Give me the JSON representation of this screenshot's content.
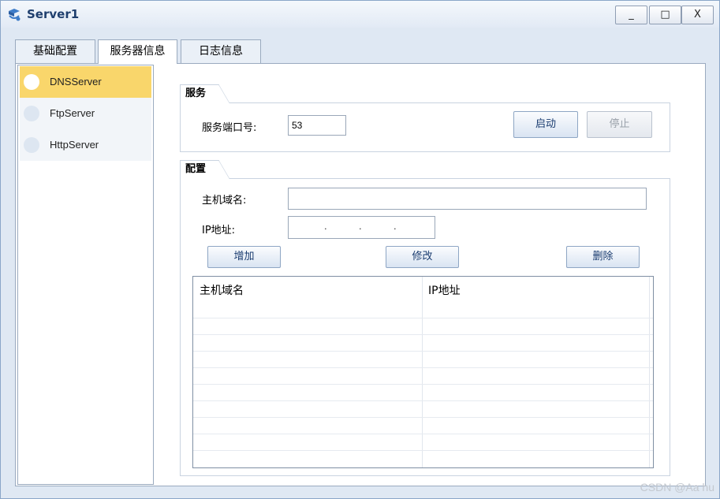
{
  "window": {
    "title": "Server1",
    "controls": {
      "minimize": "_",
      "maximize": "□",
      "close": "X"
    }
  },
  "tabs": [
    {
      "label": "基础配置",
      "active": false
    },
    {
      "label": "服务器信息",
      "active": true
    },
    {
      "label": "日志信息",
      "active": false
    }
  ],
  "sidebar": {
    "items": [
      {
        "label": "DNSServer",
        "active": true
      },
      {
        "label": "FtpServer",
        "active": false
      },
      {
        "label": "HttpServer",
        "active": false
      }
    ]
  },
  "service": {
    "group_title": "服务",
    "port_label": "服务端口号:",
    "port_value": "53",
    "start_button": "启动",
    "stop_button": "停止"
  },
  "config": {
    "group_title": "配置",
    "hostname_label": "主机域名:",
    "hostname_value": "",
    "ip_label": "IP地址:",
    "ip_separator": ".",
    "add_button": "增加",
    "modify_button": "修改",
    "delete_button": "删除"
  },
  "table": {
    "columns": [
      "主机域名",
      "IP地址"
    ],
    "rows": []
  },
  "watermark": "CSDN @Aa hu",
  "colors": {
    "accent_selected": "#f9d66b",
    "title_text": "#1f3f6e",
    "button_text": "#1a3c70"
  }
}
